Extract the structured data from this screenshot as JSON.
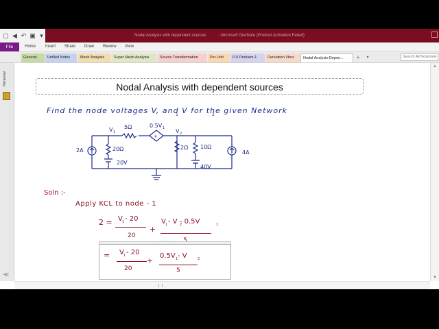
{
  "window": {
    "title_left": "Nodal Analysis with dependent sources",
    "title_right": "Microsoft OneNote (Product Activation Failed)"
  },
  "menu": {
    "file": "File",
    "items": [
      "Home",
      "Insert",
      "Share",
      "Draw",
      "Review",
      "View"
    ]
  },
  "section_tabs": [
    "General",
    "Unfiled Notes",
    "Mesh Analysis",
    "Super Mesh Analysis",
    "Source Transformation",
    "Per Unit",
    "P.U.Problem-1",
    "Derivation Vbus",
    "Nodal Analysis-Depen..."
  ],
  "active_tab_index": 8,
  "search": {
    "placeholder": "Search All Notebooks"
  },
  "left_pane": {
    "notebook": "Personal"
  },
  "page": {
    "title": "Nodal Analysis  with dependent sources",
    "problem_text": "Find  the  node  voltages  V, and V  for  the given  Network",
    "problem_sub": "1",
    "problem_sub2": "2",
    "circuit": {
      "v1": "V",
      "v1_sub": "1",
      "v2": "V",
      "v2_sub": "2",
      "r_series": "5Ω",
      "dep_src": "0.5V",
      "dep_src_sub": "1",
      "r20": "20Ω",
      "v20": "20V",
      "r2": "2Ω",
      "r10": "10Ω",
      "v40": "40V",
      "i2": "2A",
      "i4": "4A"
    },
    "soln": "Soln :-",
    "apply": "Apply  KCL  to  node - 1",
    "eq1": {
      "lhs": "2 =",
      "n1": "V - 20",
      "n1_sub": "1",
      "d1": "20",
      "plus": "+",
      "n2": "V  - V  - 0.5V",
      "n2_s1": "1",
      "n2_s2": "2",
      "n2_s3": "1",
      "d2": "5"
    },
    "eq2": {
      "lhs": "=",
      "n1": "V - 20",
      "n1_sub": "1",
      "d1": "20",
      "plus": "+",
      "n2": "0.5V  - V",
      "n2_s1": "1",
      "n2_s2": "2",
      "d2": "5"
    }
  },
  "colors": {
    "title_bar": "#7a0d1f",
    "file_tab": "#7a1a8a",
    "ink_blue": "#1b2a8a",
    "ink_red": "#a3122a"
  }
}
